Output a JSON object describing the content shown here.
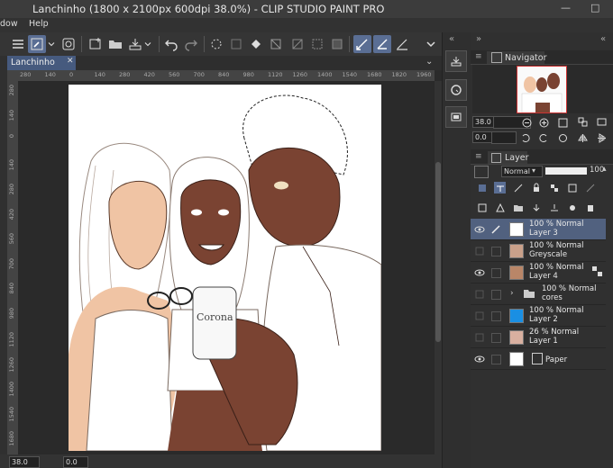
{
  "window": {
    "title": "Lanchinho (1800 x 2100px 600dpi 38.0%)  - CLIP STUDIO PAINT PRO"
  },
  "menu": {
    "items": [
      "dow",
      "Help"
    ]
  },
  "document": {
    "tab_label": "Lanchinho",
    "ruler_ticks_h": [
      "280",
      "140",
      "0",
      "140",
      "280",
      "420",
      "560",
      "700",
      "840",
      "980",
      "1120",
      "1260",
      "1400",
      "1540",
      "1680",
      "1820",
      "1960"
    ],
    "ruler_ticks_v": [
      "280",
      "140",
      "0",
      "140",
      "280",
      "420",
      "560",
      "700",
      "840",
      "980",
      "1120",
      "1260",
      "1400",
      "1540",
      "1680"
    ]
  },
  "status": {
    "zoom": "38.0",
    "rotation": "0.0"
  },
  "navigator": {
    "tab_label": "Navigator",
    "zoom": "38.0",
    "rotation": "0.0"
  },
  "layer_panel": {
    "tab_label": "Layer",
    "blend_mode": "Normal",
    "opacity": "100",
    "layers": [
      {
        "opacity": "100 % Normal",
        "name": "Layer 3",
        "selected": true,
        "thumb": "#ffffff",
        "visible": true,
        "icon": "pen-icon"
      },
      {
        "opacity": "100 % Normal",
        "name": "Greyscale",
        "selected": false,
        "thumb": "#c9a08a",
        "visible": false,
        "icon": ""
      },
      {
        "opacity": "100 % Normal",
        "name": "Layer 4",
        "selected": false,
        "thumb": "#b98668",
        "visible": true,
        "icon": ""
      },
      {
        "opacity": "100 % Normal",
        "name": "cores",
        "selected": false,
        "thumb": "folder",
        "visible": false,
        "icon": ""
      },
      {
        "opacity": "100 % Normal",
        "name": "Layer 2",
        "selected": false,
        "thumb": "#1a8fe3",
        "visible": false,
        "icon": ""
      },
      {
        "opacity": "26 % Normal",
        "name": "Layer 1",
        "selected": false,
        "thumb": "#d9b0a0",
        "visible": false,
        "icon": ""
      },
      {
        "opacity": "",
        "name": "Paper",
        "selected": false,
        "thumb": "#ffffff",
        "visible": true,
        "icon": ""
      }
    ]
  },
  "colors": {
    "accent": "#465a7e",
    "selected_layer": "#51617f",
    "skin_light": "#f0c4a4",
    "skin_dark": "#7a4332"
  }
}
